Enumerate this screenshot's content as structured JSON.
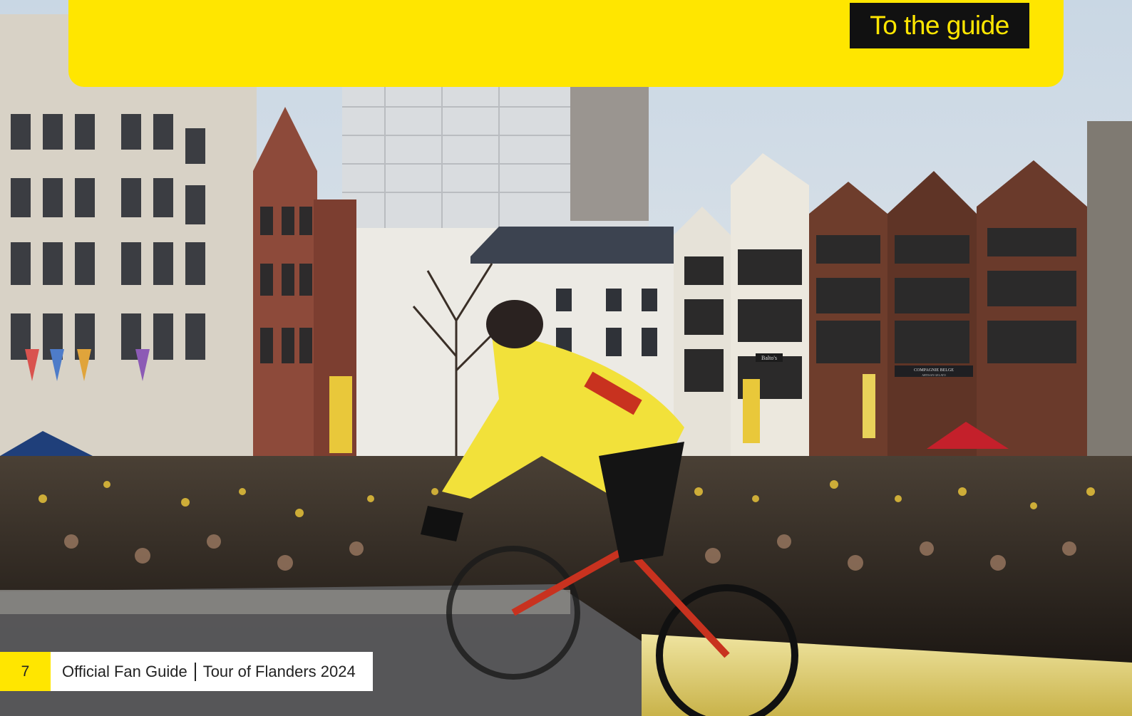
{
  "banner": {
    "button_label": "To the guide"
  },
  "footer": {
    "page_number": "7",
    "guide_name": "Official Fan Guide",
    "event_name": "Tour of Flanders 2024"
  },
  "photo": {
    "signs": [
      "Balto's",
      "COMPAGNIE BELGE",
      "ARTISAN GELATO"
    ]
  }
}
